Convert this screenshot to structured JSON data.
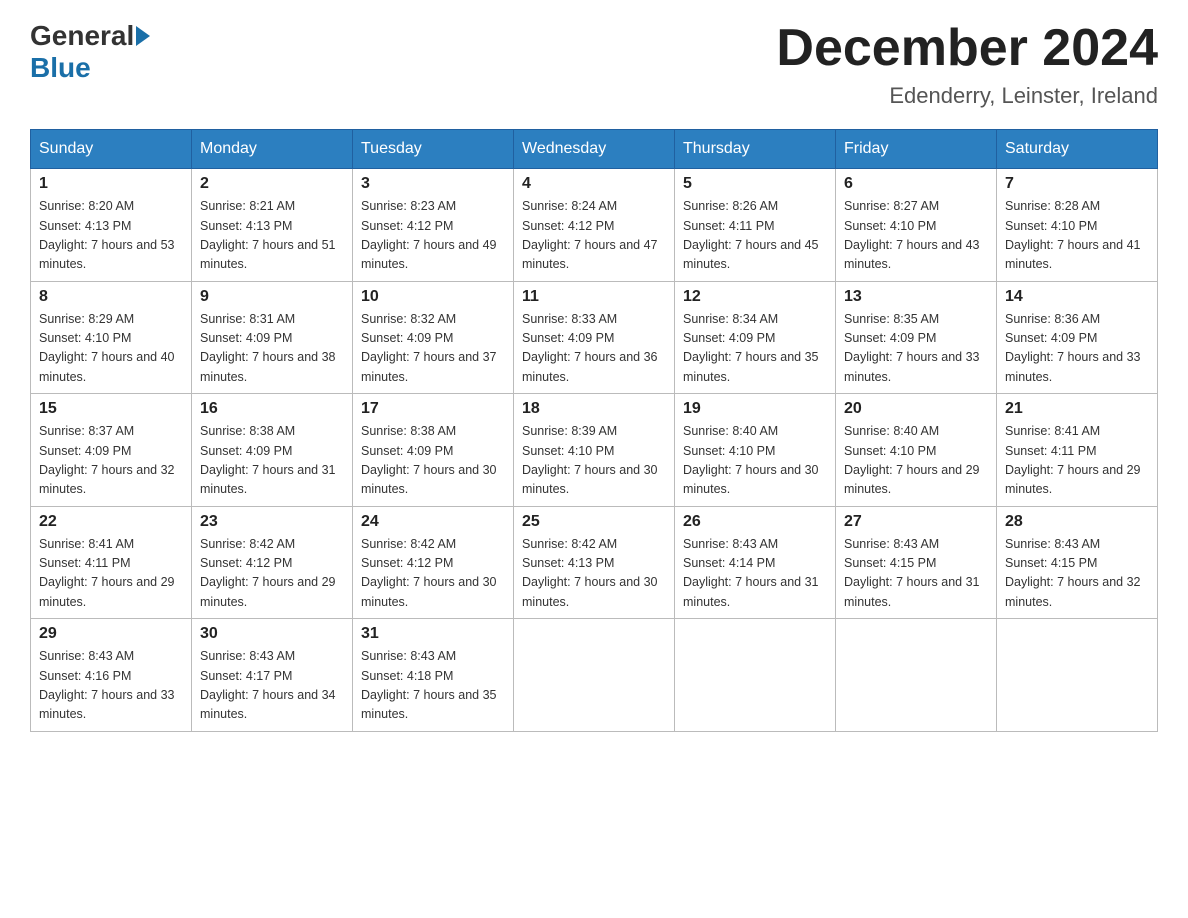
{
  "logo": {
    "general": "General",
    "blue": "Blue"
  },
  "title": "December 2024",
  "location": "Edenderry, Leinster, Ireland",
  "days_of_week": [
    "Sunday",
    "Monday",
    "Tuesday",
    "Wednesday",
    "Thursday",
    "Friday",
    "Saturday"
  ],
  "weeks": [
    [
      {
        "day": "1",
        "sunrise": "8:20 AM",
        "sunset": "4:13 PM",
        "daylight": "7 hours and 53 minutes."
      },
      {
        "day": "2",
        "sunrise": "8:21 AM",
        "sunset": "4:13 PM",
        "daylight": "7 hours and 51 minutes."
      },
      {
        "day": "3",
        "sunrise": "8:23 AM",
        "sunset": "4:12 PM",
        "daylight": "7 hours and 49 minutes."
      },
      {
        "day": "4",
        "sunrise": "8:24 AM",
        "sunset": "4:12 PM",
        "daylight": "7 hours and 47 minutes."
      },
      {
        "day": "5",
        "sunrise": "8:26 AM",
        "sunset": "4:11 PM",
        "daylight": "7 hours and 45 minutes."
      },
      {
        "day": "6",
        "sunrise": "8:27 AM",
        "sunset": "4:10 PM",
        "daylight": "7 hours and 43 minutes."
      },
      {
        "day": "7",
        "sunrise": "8:28 AM",
        "sunset": "4:10 PM",
        "daylight": "7 hours and 41 minutes."
      }
    ],
    [
      {
        "day": "8",
        "sunrise": "8:29 AM",
        "sunset": "4:10 PM",
        "daylight": "7 hours and 40 minutes."
      },
      {
        "day": "9",
        "sunrise": "8:31 AM",
        "sunset": "4:09 PM",
        "daylight": "7 hours and 38 minutes."
      },
      {
        "day": "10",
        "sunrise": "8:32 AM",
        "sunset": "4:09 PM",
        "daylight": "7 hours and 37 minutes."
      },
      {
        "day": "11",
        "sunrise": "8:33 AM",
        "sunset": "4:09 PM",
        "daylight": "7 hours and 36 minutes."
      },
      {
        "day": "12",
        "sunrise": "8:34 AM",
        "sunset": "4:09 PM",
        "daylight": "7 hours and 35 minutes."
      },
      {
        "day": "13",
        "sunrise": "8:35 AM",
        "sunset": "4:09 PM",
        "daylight": "7 hours and 33 minutes."
      },
      {
        "day": "14",
        "sunrise": "8:36 AM",
        "sunset": "4:09 PM",
        "daylight": "7 hours and 33 minutes."
      }
    ],
    [
      {
        "day": "15",
        "sunrise": "8:37 AM",
        "sunset": "4:09 PM",
        "daylight": "7 hours and 32 minutes."
      },
      {
        "day": "16",
        "sunrise": "8:38 AM",
        "sunset": "4:09 PM",
        "daylight": "7 hours and 31 minutes."
      },
      {
        "day": "17",
        "sunrise": "8:38 AM",
        "sunset": "4:09 PM",
        "daylight": "7 hours and 30 minutes."
      },
      {
        "day": "18",
        "sunrise": "8:39 AM",
        "sunset": "4:10 PM",
        "daylight": "7 hours and 30 minutes."
      },
      {
        "day": "19",
        "sunrise": "8:40 AM",
        "sunset": "4:10 PM",
        "daylight": "7 hours and 30 minutes."
      },
      {
        "day": "20",
        "sunrise": "8:40 AM",
        "sunset": "4:10 PM",
        "daylight": "7 hours and 29 minutes."
      },
      {
        "day": "21",
        "sunrise": "8:41 AM",
        "sunset": "4:11 PM",
        "daylight": "7 hours and 29 minutes."
      }
    ],
    [
      {
        "day": "22",
        "sunrise": "8:41 AM",
        "sunset": "4:11 PM",
        "daylight": "7 hours and 29 minutes."
      },
      {
        "day": "23",
        "sunrise": "8:42 AM",
        "sunset": "4:12 PM",
        "daylight": "7 hours and 29 minutes."
      },
      {
        "day": "24",
        "sunrise": "8:42 AM",
        "sunset": "4:12 PM",
        "daylight": "7 hours and 30 minutes."
      },
      {
        "day": "25",
        "sunrise": "8:42 AM",
        "sunset": "4:13 PM",
        "daylight": "7 hours and 30 minutes."
      },
      {
        "day": "26",
        "sunrise": "8:43 AM",
        "sunset": "4:14 PM",
        "daylight": "7 hours and 31 minutes."
      },
      {
        "day": "27",
        "sunrise": "8:43 AM",
        "sunset": "4:15 PM",
        "daylight": "7 hours and 31 minutes."
      },
      {
        "day": "28",
        "sunrise": "8:43 AM",
        "sunset": "4:15 PM",
        "daylight": "7 hours and 32 minutes."
      }
    ],
    [
      {
        "day": "29",
        "sunrise": "8:43 AM",
        "sunset": "4:16 PM",
        "daylight": "7 hours and 33 minutes."
      },
      {
        "day": "30",
        "sunrise": "8:43 AM",
        "sunset": "4:17 PM",
        "daylight": "7 hours and 34 minutes."
      },
      {
        "day": "31",
        "sunrise": "8:43 AM",
        "sunset": "4:18 PM",
        "daylight": "7 hours and 35 minutes."
      },
      null,
      null,
      null,
      null
    ]
  ]
}
